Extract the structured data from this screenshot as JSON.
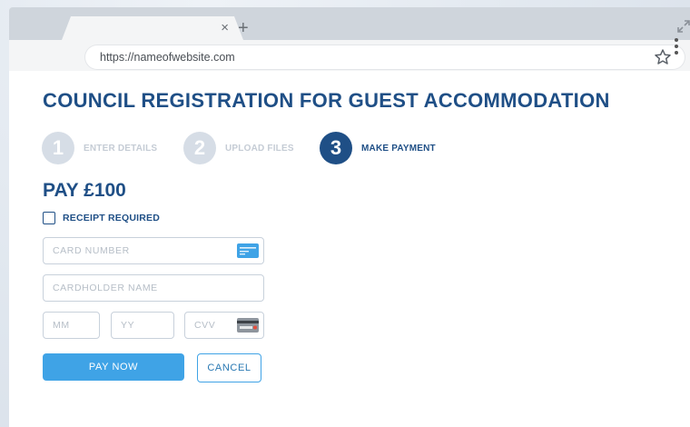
{
  "browser": {
    "tab_close": "×",
    "new_tab": "+",
    "url": "https://nameofwebsite.com"
  },
  "page": {
    "title": "COUNCIL REGISTRATION FOR GUEST ACCOMMODATION",
    "steps": [
      {
        "number": "1",
        "label": "ENTER DETAILS",
        "state": "inactive"
      },
      {
        "number": "2",
        "label": "UPLOAD FILES",
        "state": "inactive"
      },
      {
        "number": "3",
        "label": "MAKE PAYMENT",
        "state": "active"
      }
    ],
    "pay_heading": "PAY £100",
    "receipt_label": "RECEIPT REQUIRED",
    "receipt_checked": false,
    "fields": {
      "card_number_placeholder": "CARD NUMBER",
      "cardholder_placeholder": "CARDHOLDER NAME",
      "mm_placeholder": "MM",
      "yy_placeholder": "YY",
      "cvv_placeholder": "CVV"
    },
    "buttons": {
      "pay": "PAY NOW",
      "cancel": "CANCEL"
    }
  },
  "colors": {
    "brand": "#1f4f86",
    "accent": "#3fa3e6",
    "inactive": "#d6dde6"
  },
  "icons": {
    "card": "credit-card-icon",
    "cvv": "cvv-card-icon",
    "star": "star-icon",
    "menu": "more-vert-icon",
    "expand": "expand-icon"
  }
}
